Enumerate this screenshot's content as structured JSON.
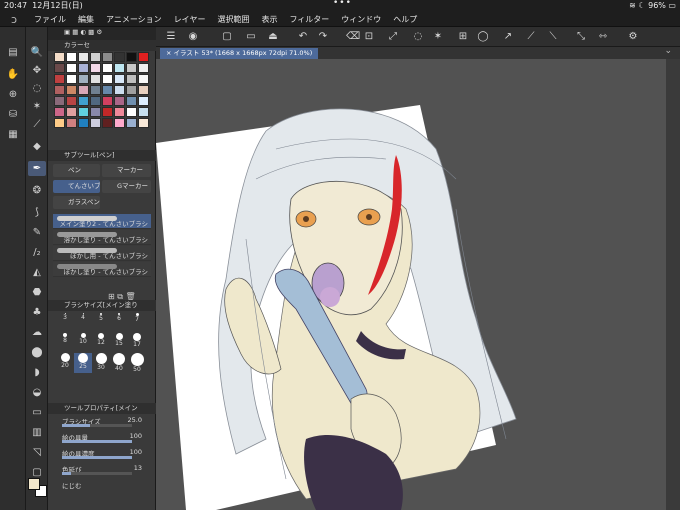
{
  "status": {
    "time": "20:47",
    "date": "12月12日(日)",
    "battery": "96%"
  },
  "menu": [
    "ファイル",
    "編集",
    "アニメーション",
    "レイヤー",
    "選択範囲",
    "表示",
    "フィルター",
    "ウィンドウ",
    "ヘルプ"
  ],
  "panels": {
    "color_set_title": "カラーセ",
    "subtool_title": "サブツール[ペン]",
    "subtools": [
      "ペン",
      "マーカー",
      "てんさいブ",
      "Gマーカー",
      "ガラスペン"
    ],
    "brushes": [
      "メイン塗り2 - てんさいブラシ",
      "溶かし塗り - てんさいブラシ",
      "ぼかし用 - てんさいブラシ",
      "ぼかし塗り - てんさいブラシ"
    ],
    "brush_size_title": "ブラシサイズ[メイン塗り",
    "brush_sizes": [
      "3",
      "4",
      "5",
      "6",
      "7",
      "8",
      "10",
      "12",
      "15",
      "17",
      "20",
      "25",
      "30",
      "40",
      "50"
    ],
    "tool_property_title": "ツールプロパティ[メイン",
    "properties": [
      {
        "label": "ブラシサイズ",
        "value": "25.0"
      },
      {
        "label": "絵の具量",
        "value": "100"
      },
      {
        "label": "絵の具濃度",
        "value": "100"
      },
      {
        "label": "色延び",
        "value": "13"
      },
      {
        "label": "にじむ",
        "value": ""
      }
    ]
  },
  "document_tab": "イラスト 53* (1668 x 1668px 72dpi 71.0%)",
  "colors": {
    "accent": "#46608c",
    "swatches": [
      "#f3dcc8",
      "#ffffff",
      "#e8e8e8",
      "#d0d0d0",
      "#8c8c8c",
      "#333333",
      "#111111",
      "#e02020",
      "#6b4a4a",
      "#ffffff",
      "#aab3d8",
      "#f3d8e8",
      "#ffffff",
      "#bde6f0",
      "#c8c8c8",
      "#f0f0f0",
      "#c04040",
      "#ffffff",
      "#a0b0c0",
      "#e0e0e0",
      "#ffffff",
      "#d8e8f8",
      "#c0c0c0",
      "#f8f8f8",
      "#b06060",
      "#cc8866",
      "#d8a8b8",
      "#708090",
      "#6688aa",
      "#ccddee",
      "#a0a0a0",
      "#e8d0c0",
      "#8a6a7a",
      "#b84444",
      "#40a0d0",
      "#506880",
      "#d04060",
      "#aa6688",
      "#7090b0",
      "#ddeeff",
      "#cc6688",
      "#e0a0a0",
      "#60d0e0",
      "#8888aa",
      "#c02828",
      "#ee8899",
      "#ffffff",
      "#c8e0f0",
      "#ffcc88",
      "#d08080",
      "#2080c0",
      "#ccccdd",
      "#602020",
      "#ffaacc",
      "#9ab0d0",
      "#f8e8d8"
    ]
  }
}
